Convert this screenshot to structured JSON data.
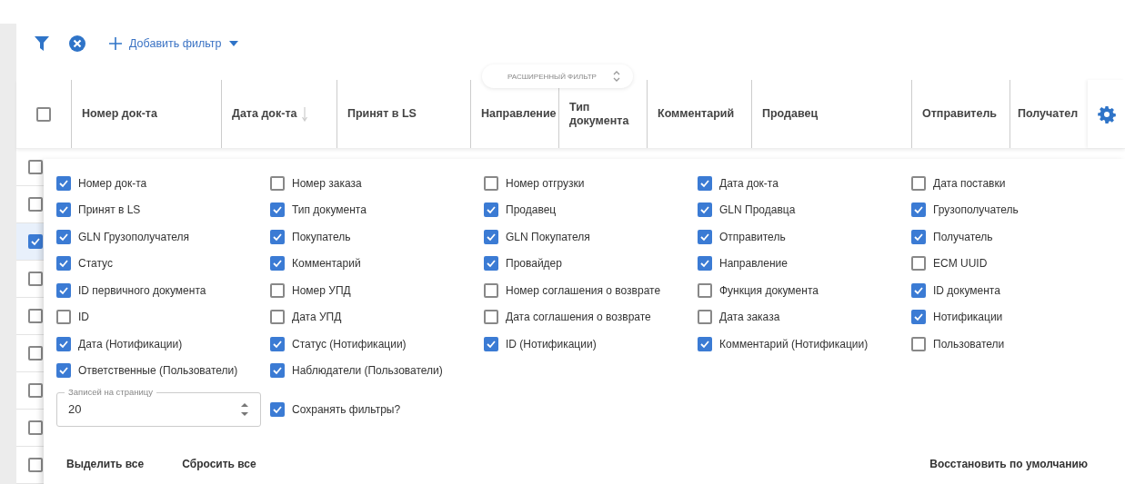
{
  "toolbar": {
    "add_filter": "Добавить фильтр"
  },
  "advanced_filter": {
    "label": "РАСШИРЕННЫЙ ФИЛЬТР"
  },
  "table": {
    "select_all": {
      "checked": false
    },
    "columns": [
      {
        "label": "Номер док-та",
        "sorted": false
      },
      {
        "label": "Дата док-та",
        "sorted": true
      },
      {
        "label": "Принят в LS",
        "sorted": false
      },
      {
        "label": "Направление",
        "sorted": false
      },
      {
        "label": "Тип документа",
        "sorted": false
      },
      {
        "label": "Комментарий",
        "sorted": false
      },
      {
        "label": "Продавец",
        "sorted": false
      },
      {
        "label": "Отправитель",
        "sorted": false
      },
      {
        "label": "Получател",
        "sorted": false
      }
    ],
    "rows": [
      {
        "selected": false
      },
      {
        "selected": false
      },
      {
        "selected": true
      },
      {
        "selected": false
      },
      {
        "selected": false
      },
      {
        "selected": false
      },
      {
        "selected": false
      },
      {
        "selected": false
      },
      {
        "selected": false
      }
    ]
  },
  "column_settings": {
    "options": [
      {
        "label": "Номер док-та",
        "checked": true
      },
      {
        "label": "Номер заказа",
        "checked": false
      },
      {
        "label": "Номер отгрузки",
        "checked": false
      },
      {
        "label": "Дата док-та",
        "checked": true
      },
      {
        "label": "Дата поставки",
        "checked": false
      },
      {
        "label": "Принят в LS",
        "checked": true
      },
      {
        "label": "Тип документа",
        "checked": true
      },
      {
        "label": "Продавец",
        "checked": true
      },
      {
        "label": "GLN Продавца",
        "checked": true
      },
      {
        "label": "Грузополучатель",
        "checked": true
      },
      {
        "label": "GLN Грузополучателя",
        "checked": true
      },
      {
        "label": "Покупатель",
        "checked": true
      },
      {
        "label": "GLN Покупателя",
        "checked": true
      },
      {
        "label": "Отправитель",
        "checked": true
      },
      {
        "label": "Получатель",
        "checked": true
      },
      {
        "label": "Статус",
        "checked": true
      },
      {
        "label": "Комментарий",
        "checked": true
      },
      {
        "label": "Провайдер",
        "checked": true
      },
      {
        "label": "Направление",
        "checked": true
      },
      {
        "label": "ECM UUID",
        "checked": false
      },
      {
        "label": "ID первичного документа",
        "checked": true
      },
      {
        "label": "Номер УПД",
        "checked": false
      },
      {
        "label": "Номер соглашения о возврате",
        "checked": false
      },
      {
        "label": "Функция документа",
        "checked": false
      },
      {
        "label": "ID документа",
        "checked": true
      },
      {
        "label": "ID",
        "checked": false
      },
      {
        "label": "Дата УПД",
        "checked": false
      },
      {
        "label": "Дата соглашения о возврате",
        "checked": false
      },
      {
        "label": "Дата заказа",
        "checked": false
      },
      {
        "label": "Нотификации",
        "checked": true
      },
      {
        "label": "Дата (Нотификации)",
        "checked": true
      },
      {
        "label": "Статус (Нотификации)",
        "checked": true
      },
      {
        "label": "ID (Нотификации)",
        "checked": true
      },
      {
        "label": "Комментарий (Нотификации)",
        "checked": true
      },
      {
        "label": "Пользователи",
        "checked": false
      },
      {
        "label": "Ответственные (Пользователи)",
        "checked": true
      },
      {
        "label": "Наблюдатели (Пользователи)",
        "checked": true
      }
    ],
    "page_size": {
      "label": "Записей на страницу",
      "value": "20"
    },
    "save_filters": {
      "label": "Сохранять фильтры?",
      "checked": true
    },
    "buttons": [
      "Выделить все",
      "Сбросить все",
      "Восстановить по умолчанию"
    ]
  }
}
